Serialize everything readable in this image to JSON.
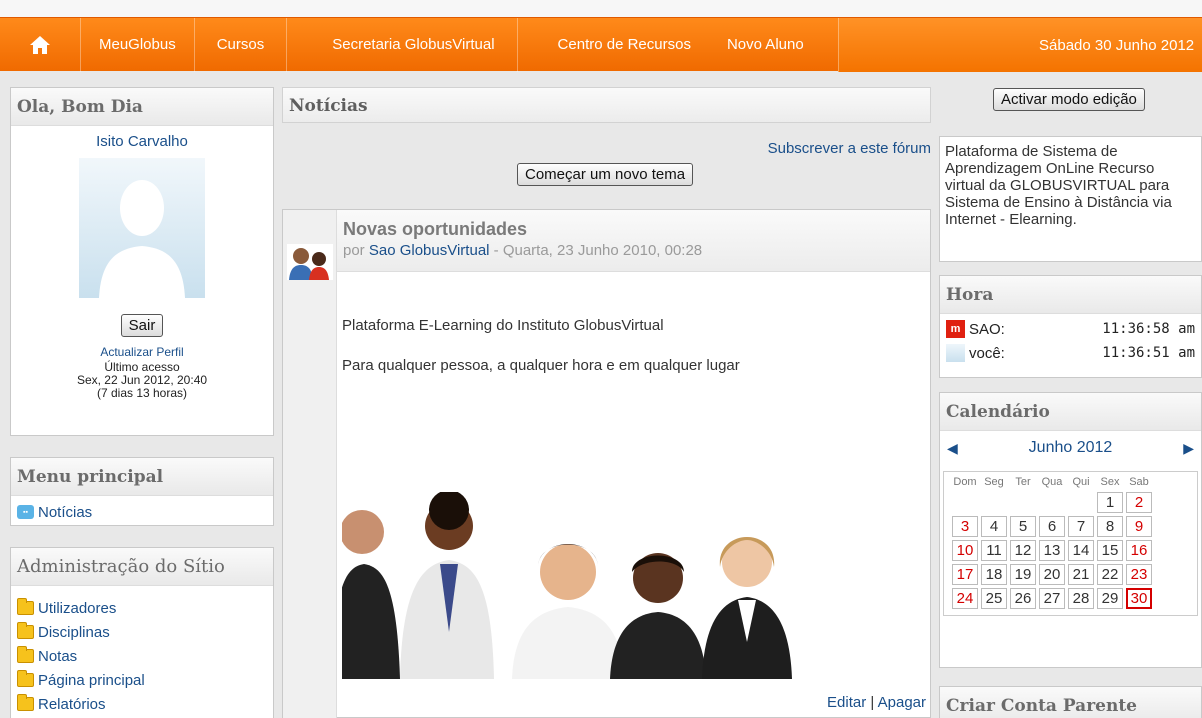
{
  "nav": {
    "items": [
      "MeuGlobus",
      "Cursos",
      "Secretaria GlobusVirtual",
      "Centro de Recursos",
      "Novo Aluno"
    ],
    "date": "Sábado 30 Junho 2012"
  },
  "profile_block": {
    "title": "Ola, Bom Dia",
    "name": "Isito Carvalho",
    "logout": "Sair",
    "update_profile": "Actualizar Perfil",
    "last_access_label": "Último acesso",
    "last_access_date": "Sex, 22 Jun 2012, 20:40",
    "last_access_ago": "(7 dias 13 horas)"
  },
  "main_menu": {
    "title": "Menu principal",
    "items": [
      "Notícias"
    ]
  },
  "site_admin": {
    "title": "Administração do Sítio",
    "items": [
      "Utilizadores",
      "Disciplinas",
      "Notas",
      "Página principal",
      "Relatórios"
    ]
  },
  "forum": {
    "title": "Notícias",
    "subscribe": "Subscrever a este fórum",
    "new_topic": "Começar um novo tema"
  },
  "post": {
    "title": "Novas oportunidades",
    "by": "por",
    "author": "Sao GlobusVirtual",
    "date": " - Quarta, 23 Junho 2010, 00:28",
    "line1": "Plataforma E-Learning do Instituto GlobusVirtual",
    "line2": "Para qualquer pessoa, a qualquer hora e em qualquer lugar",
    "edit": "Editar",
    "separator": " | ",
    "delete": "Apagar"
  },
  "right": {
    "edit_mode": "Activar modo edição",
    "description": "Plataforma de Sistema de Aprendizagem OnLine Recurso virtual da GLOBUSVIRTUAL para Sistema de Ensino à Distância via Internet - Elearning.",
    "time_title": "Hora",
    "time_rows": [
      {
        "label": "SAO:",
        "time": "11:36:58 am"
      },
      {
        "label": "você:",
        "time": "11:36:51 am"
      }
    ],
    "calendar_title": "Calendário",
    "month": "Junho 2012",
    "weekdays": [
      "Dom",
      "Seg",
      "Ter",
      "Qua",
      "Qui",
      "Sex",
      "Sab"
    ],
    "weeks": [
      [
        "",
        "",
        "",
        "",
        "",
        "1",
        "2"
      ],
      [
        "3",
        "4",
        "5",
        "6",
        "7",
        "8",
        "9"
      ],
      [
        "10",
        "11",
        "12",
        "13",
        "14",
        "15",
        "16"
      ],
      [
        "17",
        "18",
        "19",
        "20",
        "21",
        "22",
        "23"
      ],
      [
        "24",
        "25",
        "26",
        "27",
        "28",
        "29",
        "30"
      ]
    ],
    "today": "30",
    "parent_title": "Criar Conta Parente"
  },
  "colors": {
    "nav_orange": "#f47300",
    "link_blue": "#1a4f8a",
    "weekend_red": "#d40000"
  }
}
